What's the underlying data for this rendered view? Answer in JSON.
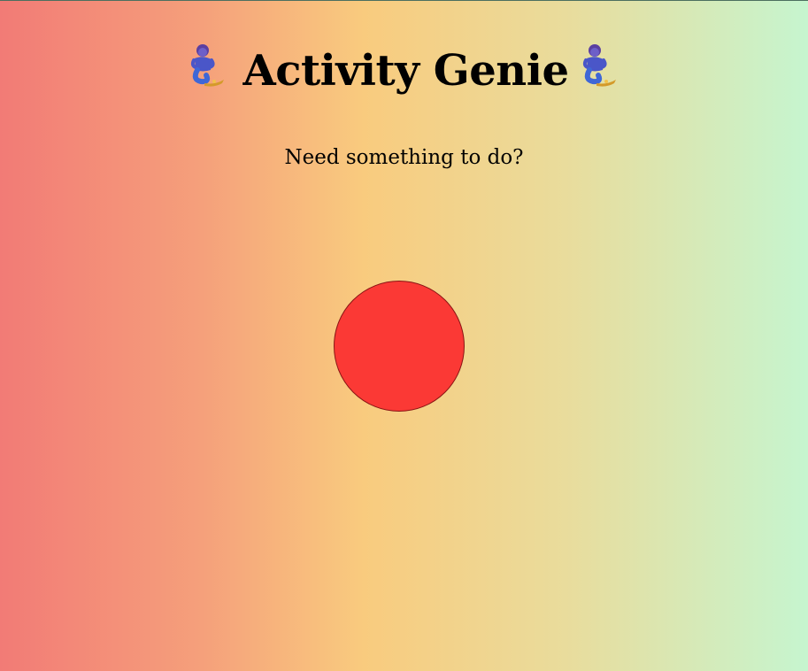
{
  "header": {
    "title": "Activity Genie",
    "left_icon": "genie-emoji-icon",
    "right_icon": "genie-emoji-icon"
  },
  "subtitle": "Need something to do?",
  "action_button": {
    "color": "#fb3935"
  }
}
